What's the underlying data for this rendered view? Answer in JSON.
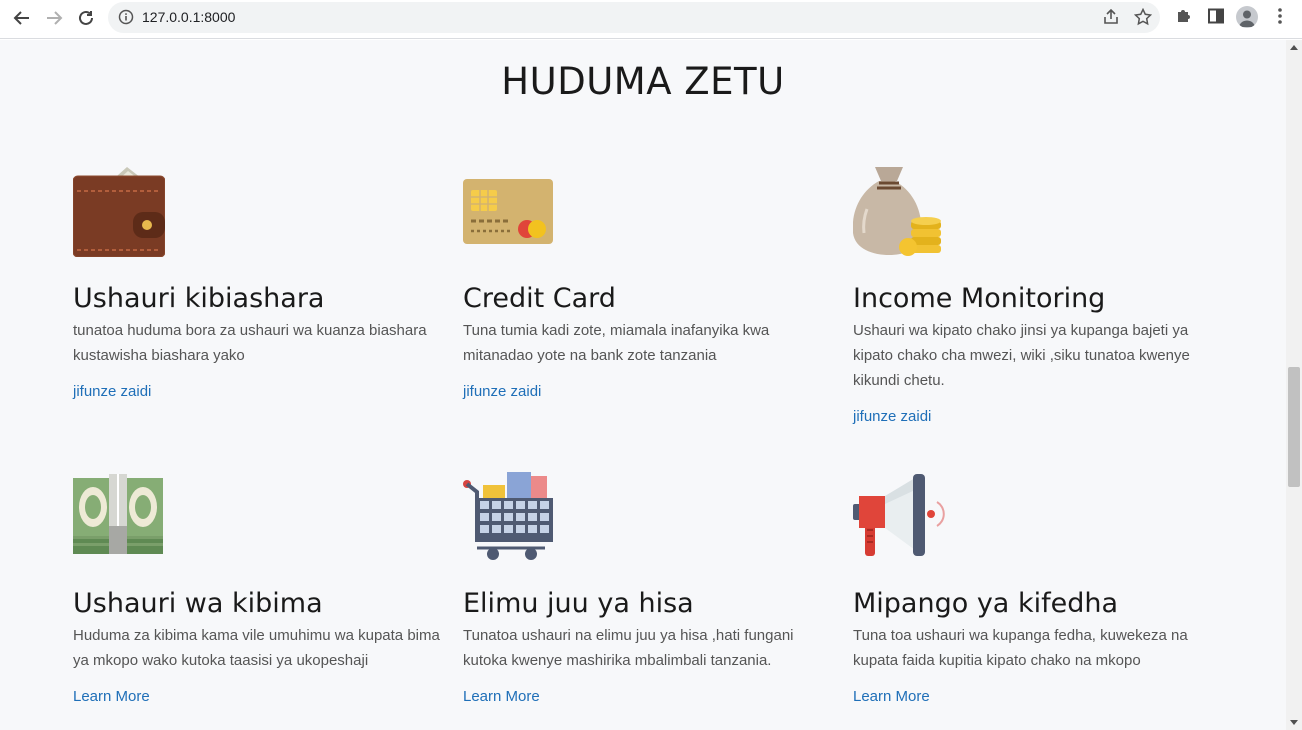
{
  "browser": {
    "url": "127.0.0.1:8000",
    "back_icon": "arrow-left-icon",
    "forward_icon": "arrow-right-icon",
    "reload_icon": "reload-icon",
    "info_icon": "info-icon",
    "share_icon": "share-icon",
    "bookmark_icon": "star-icon",
    "extensions_icon": "puzzle-icon",
    "sidepanel_icon": "side-panel-icon",
    "profile_icon": "profile-avatar-icon",
    "menu_icon": "kebab-menu-icon"
  },
  "section": {
    "title": "HUDUMA ZETU"
  },
  "services": [
    {
      "icon": "wallet-icon",
      "title": "Ushauri kibiashara",
      "description": "tunatoa huduma bora za ushauri wa kuanza biashara kustawisha biashara yako",
      "link": "jifunze zaidi"
    },
    {
      "icon": "credit-card-icon",
      "title": "Credit Card",
      "description": "Tuna tumia kadi zote, miamala inafanyika kwa mitanadao yote na bank zote tanzania",
      "link": "jifunze zaidi"
    },
    {
      "icon": "money-bag-icon",
      "title": "Income Monitoring",
      "description": "Ushauri wa kipato chako jinsi ya kupanga bajeti ya kipato chako cha mwezi, wiki ,siku tunatoa kwenye kikundi chetu.",
      "link": "jifunze zaidi"
    },
    {
      "icon": "banknote-icon",
      "title": "Ushauri wa kibima",
      "description": "Huduma za kibima kama vile umuhimu wa kupata bima ya mkopo wako kutoka taasisi ya ukopeshaji",
      "link": "Learn More"
    },
    {
      "icon": "shopping-cart-icon",
      "title": "Elimu juu ya hisa",
      "description": "Tunatoa ushauri na elimu juu ya hisa ,hati fungani kutoka kwenye mashirika mbalimbali tanzania.",
      "link": "Learn More"
    },
    {
      "icon": "megaphone-icon",
      "title": "Mipango ya kifedha",
      "description": "Tuna toa ushauri wa kupanga fedha, kuwekeza na kupata faida kupitia kipato chako na mkopo",
      "link": "Learn More"
    }
  ],
  "colors": {
    "link": "#1f6fb8",
    "page_background": "#f7f8fa"
  }
}
